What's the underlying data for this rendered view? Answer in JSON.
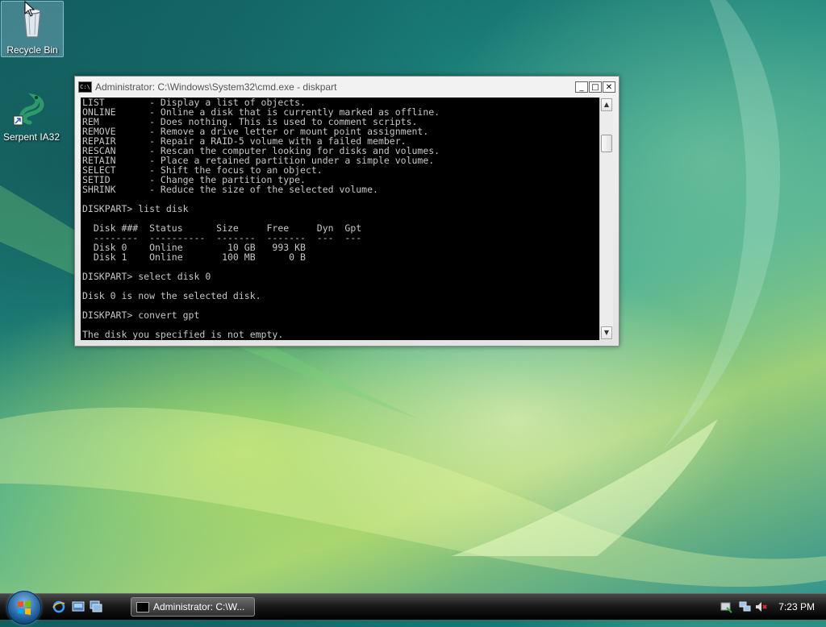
{
  "desktop": {
    "icons": [
      {
        "label": "Recycle Bin",
        "icon": "recycle-bin-icon"
      },
      {
        "label": "Serpent IA32",
        "icon": "serpent-shortcut-icon"
      }
    ]
  },
  "cmd_window": {
    "title": "Administrator: C:\\Windows\\System32\\cmd.exe - diskpart",
    "buttons": {
      "minimize": "_",
      "maximize": "□",
      "close": "✕"
    },
    "console_lines": [
      "LIST        - Display a list of objects.",
      "ONLINE      - Online a disk that is currently marked as offline.",
      "REM         - Does nothing. This is used to comment scripts.",
      "REMOVE      - Remove a drive letter or mount point assignment.",
      "REPAIR      - Repair a RAID-5 volume with a failed member.",
      "RESCAN      - Rescan the computer looking for disks and volumes.",
      "RETAIN      - Place a retained partition under a simple volume.",
      "SELECT      - Shift the focus to an object.",
      "SETID       - Change the partition type.",
      "SHRINK      - Reduce the size of the selected volume.",
      "",
      "DISKPART> list disk",
      "",
      "  Disk ###  Status      Size     Free     Dyn  Gpt",
      "  --------  ----------  -------  -------  ---  ---",
      "  Disk 0    Online        10 GB   993 KB",
      "  Disk 1    Online       100 MB      0 B",
      "",
      "DISKPART> select disk 0",
      "",
      "Disk 0 is now the selected disk.",
      "",
      "DISKPART> convert gpt",
      "",
      "The disk you specified is not empty."
    ]
  },
  "taskbar": {
    "task_button_label": "Administrator: C:\\W...",
    "clock": "7:23 PM",
    "quick_launch": [
      "internet-explorer-icon",
      "show-desktop-icon",
      "switch-windows-icon"
    ],
    "tray_icons": [
      "network-icon",
      "volume-muted-icon",
      "security-icon"
    ]
  }
}
